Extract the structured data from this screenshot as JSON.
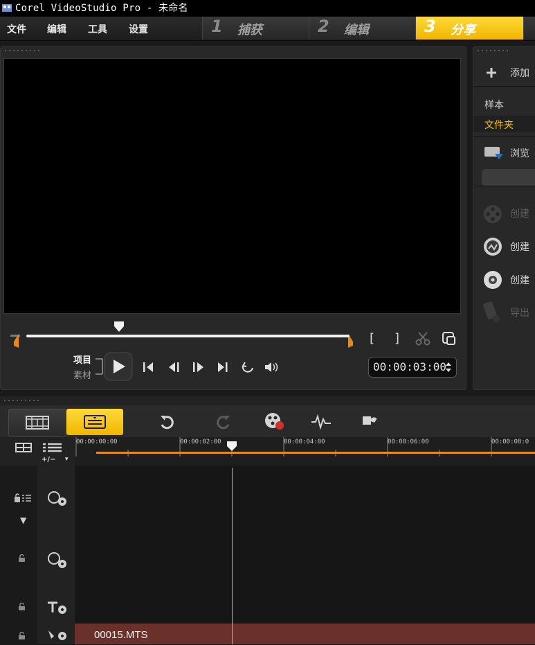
{
  "window": {
    "title": "Corel VideoStudio Pro - 未命名"
  },
  "menu": {
    "items": [
      "文件",
      "编辑",
      "工具",
      "设置"
    ]
  },
  "steps": [
    {
      "num": "1",
      "label": "捕获",
      "active": false
    },
    {
      "num": "2",
      "label": "编辑",
      "active": false
    },
    {
      "num": "3",
      "label": "分享",
      "active": true
    }
  ],
  "player": {
    "mode_project": "项目",
    "mode_clip": "素材",
    "timecode": "00:00:03:00",
    "mark_in": "[",
    "mark_out": "]",
    "scrub_position": 0.3
  },
  "library": {
    "add_label": "添加",
    "sample_label": "样本",
    "folder_label": "文件夹",
    "browse_label": "浏览",
    "actions": [
      {
        "label": "创建",
        "enabled": false,
        "icon": "film-reel-icon"
      },
      {
        "label": "创建",
        "enabled": true,
        "icon": "disc-burn-icon"
      },
      {
        "label": "创建",
        "enabled": true,
        "icon": "dvd-disc-icon"
      },
      {
        "label": "导出",
        "enabled": false,
        "icon": "export-device-icon"
      }
    ]
  },
  "timeline": {
    "ruler_labels": [
      "00:00:00:00",
      "00:00:02:00",
      "00:00:04:00",
      "00:00:06:00",
      "00:00:08:0"
    ],
    "zoom_toggle": "+/−",
    "clip_name": "00015.MTS"
  },
  "colors": {
    "accent": "#f6c21a",
    "playhead": "#7fb6ff",
    "orange": "#e88a17",
    "clip": "#6a302a"
  }
}
